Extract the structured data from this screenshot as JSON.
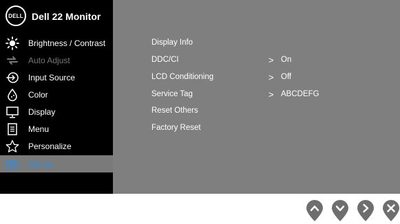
{
  "header": {
    "logo_text": "DELL",
    "model": "Dell 22 Monitor"
  },
  "sidebar": {
    "items": [
      {
        "label": "Brightness / Contrast",
        "icon": "brightness-icon"
      },
      {
        "label": "Auto Adjust",
        "icon": "auto-adjust-icon"
      },
      {
        "label": "Input Source",
        "icon": "input-source-icon"
      },
      {
        "label": "Color",
        "icon": "color-icon"
      },
      {
        "label": "Display",
        "icon": "display-icon"
      },
      {
        "label": "Menu",
        "icon": "menu-icon"
      },
      {
        "label": "Personalize",
        "icon": "star-icon"
      },
      {
        "label": "Others",
        "icon": "others-icon"
      }
    ]
  },
  "main": {
    "rows": [
      {
        "name": "Display Info",
        "chev": "",
        "value": ""
      },
      {
        "name": "DDC/CI",
        "chev": ">",
        "value": "On"
      },
      {
        "name": "LCD Conditioning",
        "chev": ">",
        "value": "Off"
      },
      {
        "name": "Service Tag",
        "chev": ">",
        "value": "ABCDEFG"
      },
      {
        "name": "Reset Others",
        "chev": "",
        "value": ""
      },
      {
        "name": "Factory Reset",
        "chev": "",
        "value": ""
      }
    ]
  },
  "buttons": [
    "up-button",
    "down-button",
    "right-button",
    "exit-button"
  ],
  "colors": {
    "sidebar_bg": "#000000",
    "main_bg": "#7f7f7f",
    "active_bg": "#7a7a7a",
    "active_text": "#2b8fe0",
    "button": "#6e6e6e"
  }
}
